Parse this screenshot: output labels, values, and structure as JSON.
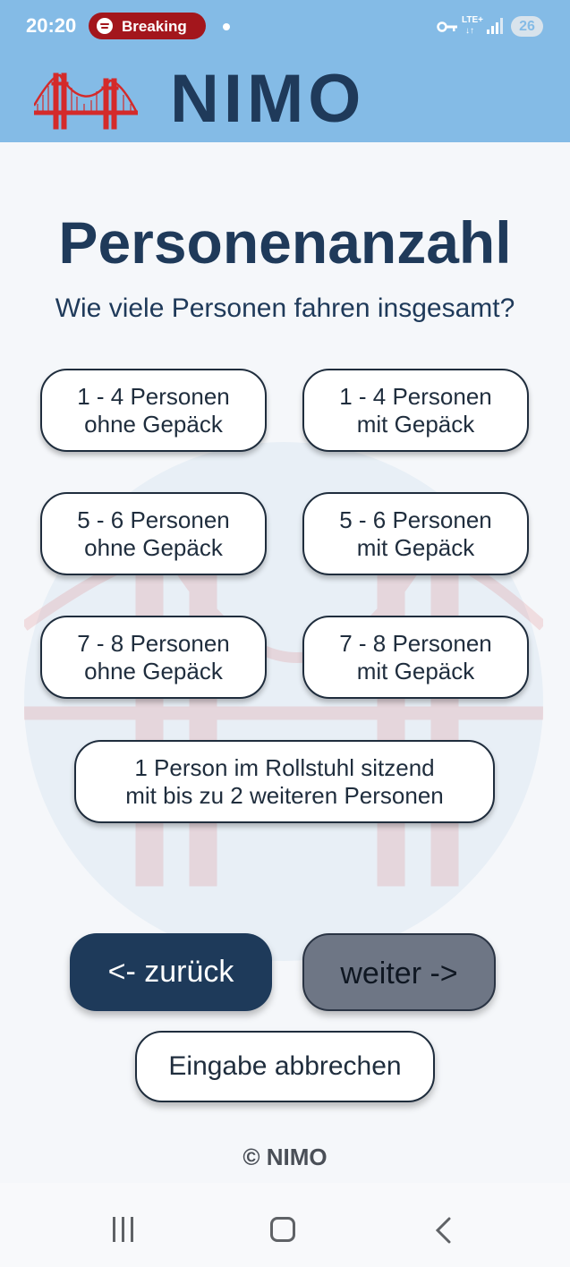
{
  "status_bar": {
    "time": "20:20",
    "notification_pill": "Breaking",
    "network": "LTE+",
    "network_arrows": "↓↑",
    "battery": "26"
  },
  "header": {
    "brand": "NIMO",
    "logo_icon": "golden-gate-bridge-icon"
  },
  "main": {
    "title": "Personenanzahl",
    "question": "Wie viele Personen fahren insgesamt?",
    "options": [
      {
        "line1": "1 - 4  Personen",
        "line2": "ohne Gepäck"
      },
      {
        "line1": "1 - 4  Personen",
        "line2": "mit Gepäck"
      },
      {
        "line1": "5 - 6  Personen",
        "line2": "ohne Gepäck"
      },
      {
        "line1": "5 - 6  Personen",
        "line2": "mit Gepäck"
      },
      {
        "line1": "7 - 8  Personen",
        "line2": "ohne Gepäck"
      },
      {
        "line1": "7 - 8  Personen",
        "line2": "mit Gepäck"
      },
      {
        "line1": "1 Person im Rollstuhl sitzend",
        "line2": "mit bis zu 2 weiteren Personen"
      }
    ],
    "back_label": "<- zurück",
    "next_label": "weiter ->",
    "cancel_label": "Eingabe abbrechen"
  },
  "footer": {
    "copyright": "© NIMO"
  },
  "colors": {
    "header_bg": "#84bbe6",
    "brand": "#1f3a5a",
    "logo_red": "#d42a2a",
    "back_button": "#1e3a5a",
    "next_button_disabled": "#6e7685"
  }
}
